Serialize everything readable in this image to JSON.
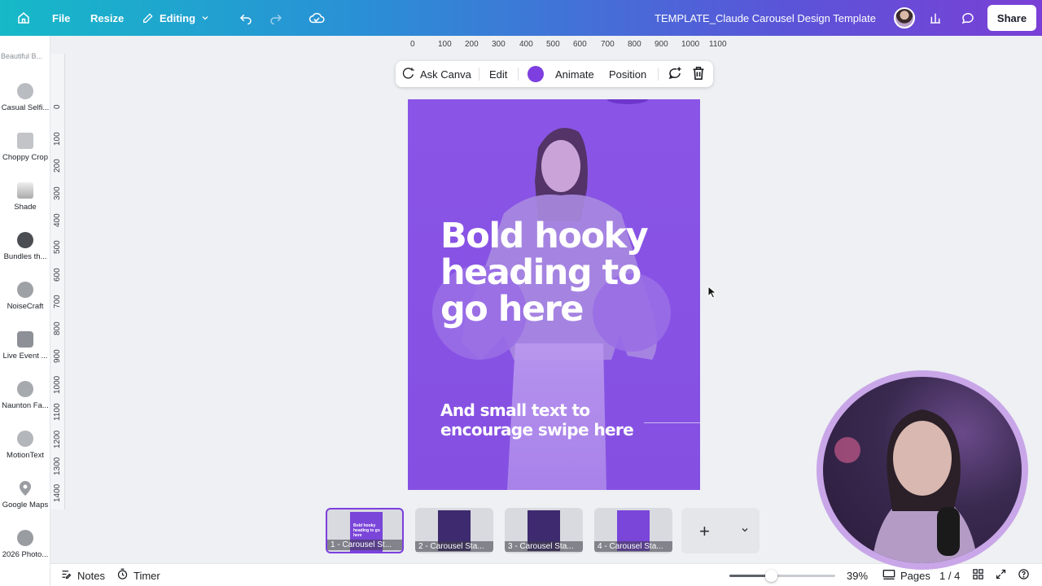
{
  "topbar": {
    "file": "File",
    "resize": "Resize",
    "editing": "Editing",
    "title": "TEMPLATE_Claude Carousel Design Template",
    "share": "Share",
    "icons": [
      "home-icon",
      "pencil-icon",
      "chevron-down-icon",
      "undo-icon",
      "redo-icon",
      "cloud-saved-icon",
      "analytics-icon",
      "comment-icon"
    ]
  },
  "apps_panel": {
    "top_label": "Beautiful B...",
    "items": [
      {
        "label": "Casual Selfi..."
      },
      {
        "label": "Choppy Crop"
      },
      {
        "label": "Shade"
      },
      {
        "label": "Bundles th..."
      },
      {
        "label": "NoiseCraft"
      },
      {
        "label": "Live Event ..."
      },
      {
        "label": "Naunton Fa..."
      },
      {
        "label": "MotionText"
      },
      {
        "label": "Google Maps"
      },
      {
        "label": "2026 Photo..."
      }
    ]
  },
  "ruler": {
    "top": [
      "0",
      "100",
      "200",
      "300",
      "400",
      "500",
      "600",
      "700",
      "800",
      "900",
      "1000",
      "1100"
    ],
    "left": [
      "0",
      "100",
      "200",
      "300",
      "400",
      "500",
      "600",
      "700",
      "800",
      "900",
      "1000",
      "1100",
      "1200",
      "1300",
      "1400"
    ]
  },
  "floating_toolbar": {
    "ask_canva": "Ask Canva",
    "edit": "Edit",
    "color": "#7d3fe0",
    "animate": "Animate",
    "position": "Position"
  },
  "canvas": {
    "heading": "Bold hooky heading to go here",
    "subtext": "And small text to encourage swipe here",
    "background": "#8a55e6"
  },
  "pages": {
    "thumbnails": [
      {
        "caption": "1 - Carousel St...",
        "active": true,
        "mini": "Bold hooky heading to go here"
      },
      {
        "caption": "2 - Carousel Sta...",
        "active": false,
        "mini": ""
      },
      {
        "caption": "3 - Carousel Sta...",
        "active": false,
        "mini": ""
      },
      {
        "caption": "4 - Carousel Sta...",
        "active": false,
        "mini": ""
      }
    ]
  },
  "bottombar": {
    "notes": "Notes",
    "timer": "Timer",
    "zoom": "39%",
    "zoom_level": 0.39,
    "pages_label": "Pages",
    "page_count": "1 / 4"
  }
}
